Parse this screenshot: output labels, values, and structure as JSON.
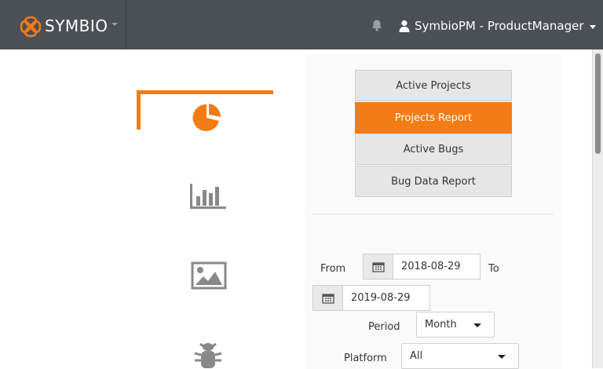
{
  "header": {
    "brand": "SYMBIO",
    "user_label": "SymbioPM - ProductManager",
    "icons": {
      "logo": "symbio-logo-icon",
      "bell": "bell-icon",
      "user": "user-icon"
    }
  },
  "sidebar": {
    "items": [
      {
        "icon": "pie-chart-icon",
        "active": true
      },
      {
        "icon": "bar-chart-icon",
        "active": false
      },
      {
        "icon": "image-icon",
        "active": false
      },
      {
        "icon": "bug-icon",
        "active": false
      }
    ]
  },
  "reports": {
    "menu": [
      {
        "label": "Active Projects",
        "active": false
      },
      {
        "label": "Projects Report",
        "active": true
      },
      {
        "label": "Active Bugs",
        "active": false
      },
      {
        "label": "Bug Data Report",
        "active": false
      }
    ]
  },
  "filters": {
    "from_label": "From",
    "from_value": "2018-08-29",
    "to_label": "To",
    "to_value": "2019-08-29",
    "period_label": "Period",
    "period_value": "Month",
    "platform_label": "Platform",
    "platform_value": "All"
  },
  "colors": {
    "accent": "#f57c14",
    "header_bg": "#4b4f56",
    "icon_gray": "#888888"
  }
}
